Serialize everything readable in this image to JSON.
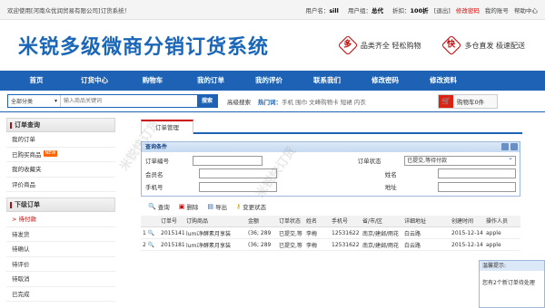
{
  "topbar": {
    "welcome": "欢迎使用[河南众优润贸易有限公司]订货系统！",
    "user_label": "用户名：",
    "user_name": "sill",
    "account_label": "用户组：",
    "account_value": "总代",
    "discount_label": "折扣：",
    "discount_value": "100折",
    "logout": "[退出]",
    "change_pwd": "修改密码",
    "my_account": "我的账号",
    "help": "帮助中心"
  },
  "header": {
    "logo": "米锐多级微商分销订货系统",
    "promo1_icon": "多",
    "promo1_text": "品类齐全  轻松购物",
    "promo2_icon": "快",
    "promo2_text": "多仓直发  极速配送"
  },
  "nav": [
    "首页",
    "订货中心",
    "购物车",
    "我的订单",
    "我的评价",
    "联系我们",
    "修改密码",
    "修改资料"
  ],
  "search": {
    "category": "全部分类",
    "placeholder": "输入商品关键词",
    "button": "搜索",
    "advanced": "高级搜索",
    "hot_label": "热门词：",
    "hot_words": "手机 围巾 文峰购物卡 短裙 内衣",
    "cart": "购物车0件"
  },
  "sidebar": {
    "section1": "订单查询",
    "items1": [
      "我的订单",
      "已购买商品",
      "我的收藏夹",
      "评价商品"
    ],
    "new_badge": "NEW",
    "section2": "下级订单",
    "items2": [
      "> 待付款",
      "待发货",
      "待确认",
      "待评价",
      "待取消",
      "已完成"
    ]
  },
  "content": {
    "tab": "订单管理",
    "panel_title": "查询条件",
    "fields": {
      "order_no": "订单编号",
      "status": "订单状态",
      "status_value": "已提交,等待付款",
      "member": "会员名",
      "name": "姓名",
      "phone": "手机号",
      "address": "地址"
    },
    "toolbar": [
      "查询",
      "删除",
      "导出",
      "变更状态"
    ]
  },
  "table": {
    "headers": [
      "",
      "订单号",
      "订购商品",
      "金额",
      "订单状态",
      "姓名",
      "手机号",
      "省/市/区",
      "详细地址",
      "创建时间",
      "操作人员"
    ],
    "rows": [
      [
        "1",
        "20151414",
        "lumi净酵素月享装",
        "(36; 289",
        "已提交,等",
        "李梅",
        "12531622",
        "南京/建邺/雨花",
        "白云路",
        "2015-12-14",
        "apple"
      ],
      [
        "2",
        "20151814",
        "lumi净酵素月享装",
        "(36; 289",
        "已提交,等",
        "李梅",
        "12531622",
        "南京/建邺/雨花",
        "白云路",
        "2015-12-14",
        "apple"
      ]
    ]
  },
  "popup": {
    "title": "温馨提示:",
    "body": "您有2个新订单待处理"
  },
  "watermark": "米锐快订货"
}
